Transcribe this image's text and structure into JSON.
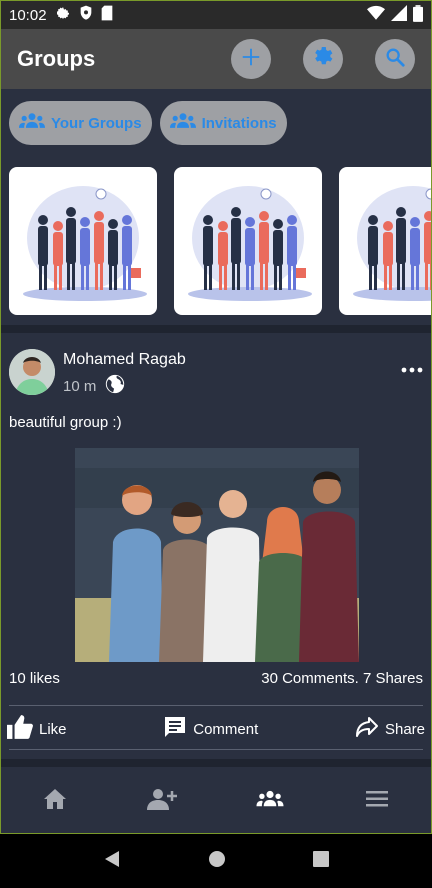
{
  "status_bar": {
    "time": "10:02"
  },
  "app_bar": {
    "title": "Groups"
  },
  "chips": {
    "your_groups": "Your Groups",
    "invitations": "Invitations"
  },
  "post": {
    "author": "Mohamed Ragab",
    "time": "10 m",
    "text": "beautiful group :)",
    "likes": "10 likes",
    "comments_shares": "30 Comments. 7 Shares",
    "like_label": "Like",
    "comment_label": "Comment",
    "share_label": "Share"
  },
  "colors": {
    "accent": "#2b8ae6",
    "background": "#2a3040",
    "app_bar": "#4a4a4a"
  },
  "icons": {
    "status": [
      "gear-icon",
      "shield-icon",
      "sd-card-icon",
      "wifi-icon",
      "signal-icon",
      "battery-icon"
    ],
    "app_bar": [
      "plus-icon",
      "gear-icon",
      "search-icon"
    ],
    "bottom_nav": [
      "home-icon",
      "add-friend-icon",
      "groups-icon",
      "menu-icon"
    ]
  }
}
